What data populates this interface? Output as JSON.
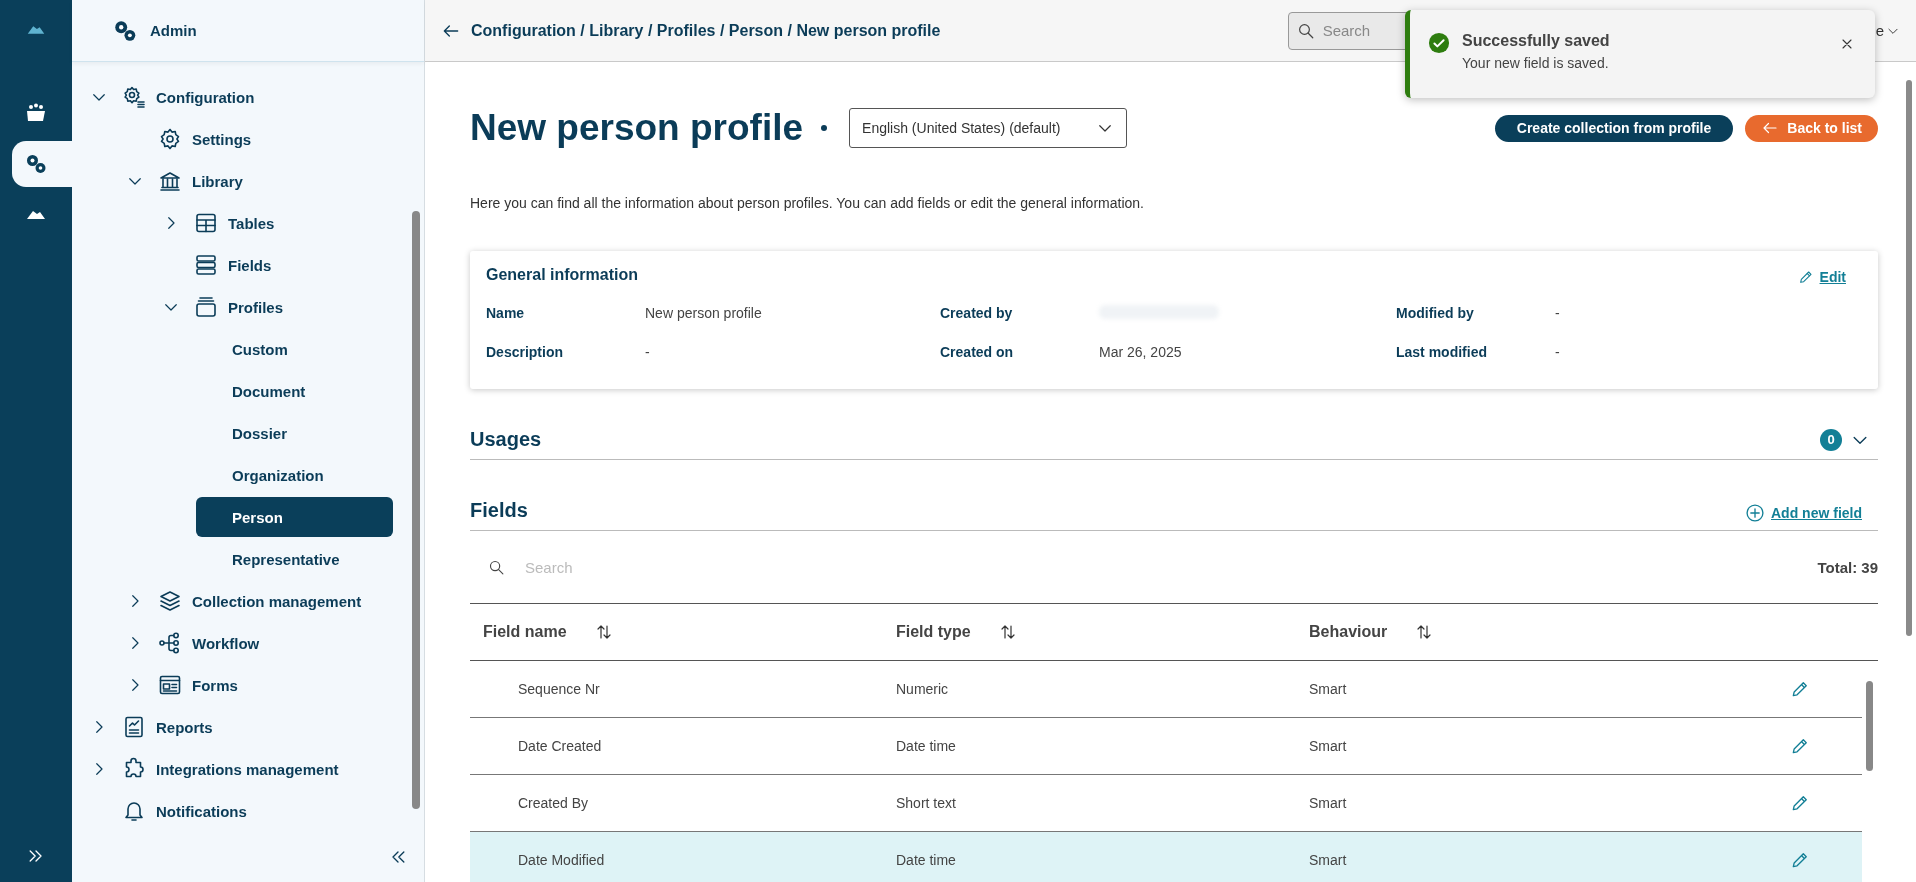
{
  "rail": {
    "items": [
      {
        "selected": false
      },
      {
        "selected": true
      },
      {
        "selected": false
      }
    ]
  },
  "sidebar": {
    "title": "Admin",
    "items": [
      {
        "label": "Configuration",
        "selected": false,
        "expanded": true,
        "children": [
          {
            "label": "Settings",
            "selected": false
          },
          {
            "label": "Library",
            "selected": false,
            "expanded": true,
            "children": [
              {
                "label": "Tables",
                "selected": false,
                "expanded": false
              },
              {
                "label": "Fields",
                "selected": false
              },
              {
                "label": "Profiles",
                "selected": false,
                "expanded": true,
                "children": [
                  {
                    "label": "Custom",
                    "selected": false
                  },
                  {
                    "label": "Document",
                    "selected": false
                  },
                  {
                    "label": "Dossier",
                    "selected": false
                  },
                  {
                    "label": "Organization",
                    "selected": false
                  },
                  {
                    "label": "Person",
                    "selected": true
                  },
                  {
                    "label": "Representative",
                    "selected": false
                  }
                ]
              }
            ]
          },
          {
            "label": "Collection management",
            "selected": false,
            "expanded": false
          },
          {
            "label": "Workflow",
            "selected": false,
            "expanded": false
          },
          {
            "label": "Forms",
            "selected": false,
            "expanded": false
          }
        ]
      },
      {
        "label": "Reports",
        "selected": false,
        "expanded": false
      },
      {
        "label": "Integrations management",
        "selected": false,
        "expanded": false
      },
      {
        "label": "Notifications",
        "selected": false
      }
    ]
  },
  "header": {
    "breadcrumb": "Configuration / Library / Profiles / Person / New person profile",
    "search": {
      "placeholder": "Search"
    },
    "user_menu": "e"
  },
  "toast": {
    "title": "Successfully saved",
    "message": "Your new field is saved."
  },
  "page": {
    "title": "New person profile",
    "language": "English (United States) (default)",
    "buttons": [
      {
        "label": "Create collection from profile",
        "kind": "primary"
      },
      {
        "label": "Back to list",
        "kind": "back"
      }
    ],
    "description": "Here you can find all the information about person profiles. You can add fields or edit the general information."
  },
  "general_information": {
    "title": "General information",
    "edit": "Edit",
    "rows": [
      [
        {
          "label": "Name",
          "value": "New person profile"
        },
        {
          "label": "Created by",
          "redacted": true
        },
        {
          "label": "Modified by",
          "value": "-"
        }
      ],
      [
        {
          "label": "Description",
          "value": "-"
        },
        {
          "label": "Created on",
          "value": "Mar 26, 2025"
        },
        {
          "label": "Last modified",
          "value": "-"
        }
      ]
    ]
  },
  "usages": {
    "title": "Usages",
    "count": "0",
    "expanded": false
  },
  "fields": {
    "title": "Fields",
    "add": "Add new field",
    "search": {
      "placeholder": "Search"
    },
    "total": "Total: 39",
    "columns": [
      "Field name",
      "Field type",
      "Behaviour"
    ],
    "rows": [
      {
        "cells": [
          "Sequence Nr",
          "Numeric",
          "Smart"
        ],
        "selected": false
      },
      {
        "cells": [
          "Date Created",
          "Date time",
          "Smart"
        ],
        "selected": false
      },
      {
        "cells": [
          "Created By",
          "Short text",
          "Smart"
        ],
        "selected": false
      },
      {
        "cells": [
          "Date Modified",
          "Date time",
          "Smart"
        ],
        "selected": true
      }
    ]
  }
}
